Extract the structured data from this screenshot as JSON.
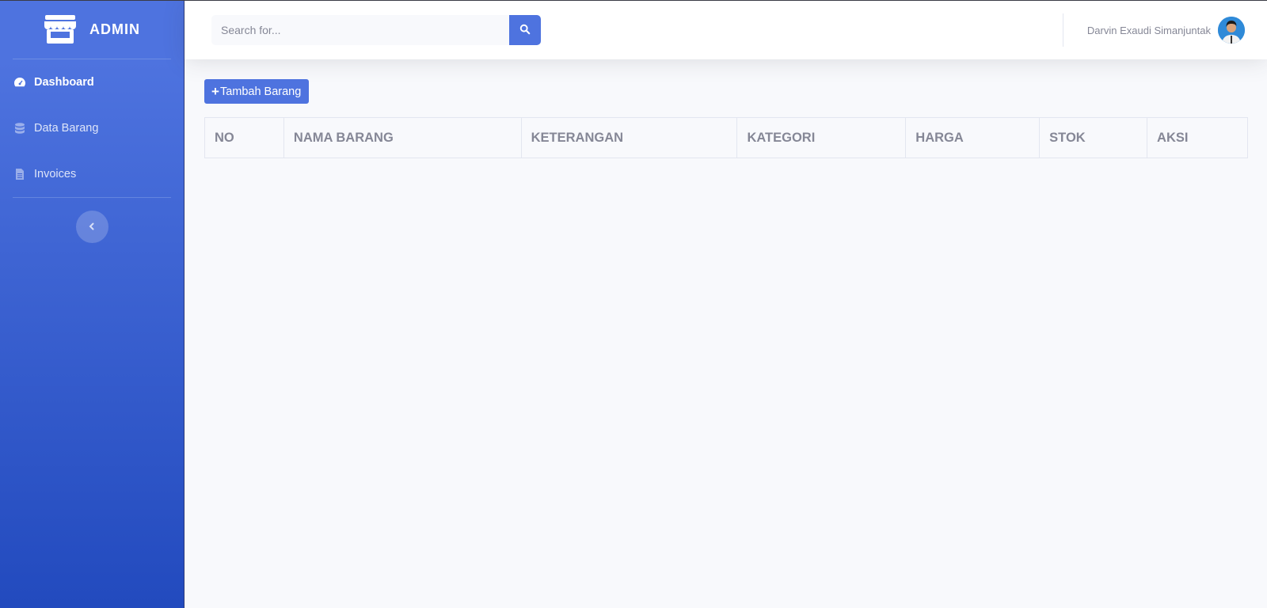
{
  "sidebar": {
    "brand": "ADMIN",
    "items": [
      {
        "label": "Dashboard",
        "icon": "tachometer-icon",
        "active": true
      },
      {
        "label": "Data Barang",
        "icon": "database-icon",
        "active": false
      },
      {
        "label": "Invoices",
        "icon": "file-icon",
        "active": false
      }
    ],
    "toggle_icon": "chevron-left-icon"
  },
  "topbar": {
    "search_placeholder": "Search for...",
    "search_icon": "search-icon",
    "user_name": "Darvin Exaudi Simanjuntak"
  },
  "main": {
    "add_button_label": "Tambah Barang",
    "table": {
      "columns": [
        "NO",
        "NAMA BARANG",
        "KETERANGAN",
        "KATEGORI",
        "HARGA",
        "STOK",
        "AKSI"
      ],
      "rows": []
    }
  },
  "colors": {
    "primary": "#4e73df",
    "sidebar_gradient_end": "#224abe",
    "background": "#f8f9fc",
    "text_muted": "#858796"
  }
}
